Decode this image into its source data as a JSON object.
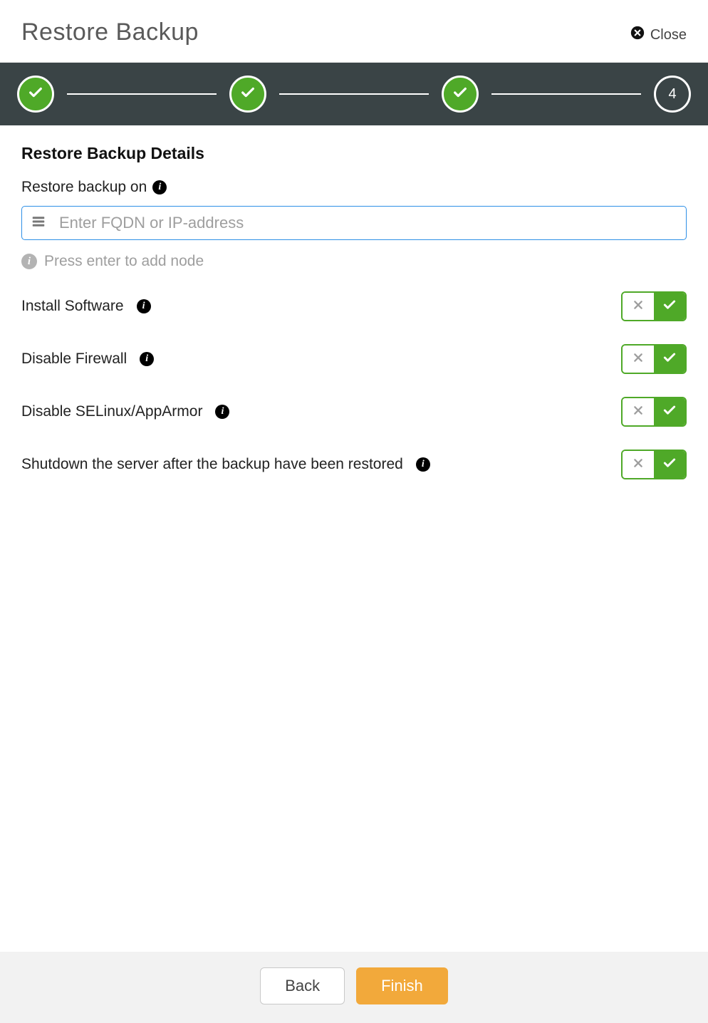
{
  "header": {
    "title": "Restore Backup",
    "close_label": "Close"
  },
  "stepper": {
    "steps_done": [
      1,
      2,
      3
    ],
    "current_step_number": "4"
  },
  "details": {
    "section_title": "Restore Backup Details",
    "restore_on_label": "Restore backup on",
    "input_placeholder": "Enter FQDN or IP-address",
    "input_value": "",
    "hint_text": "Press enter to add node"
  },
  "options": [
    {
      "id": "install-software",
      "label": "Install Software",
      "enabled": true
    },
    {
      "id": "disable-firewall",
      "label": "Disable Firewall",
      "enabled": true
    },
    {
      "id": "disable-selinux",
      "label": "Disable SELinux/AppArmor",
      "enabled": true
    },
    {
      "id": "shutdown-server",
      "label": "Shutdown the server after the backup have been restored",
      "enabled": true
    }
  ],
  "footer": {
    "back_label": "Back",
    "finish_label": "Finish"
  }
}
